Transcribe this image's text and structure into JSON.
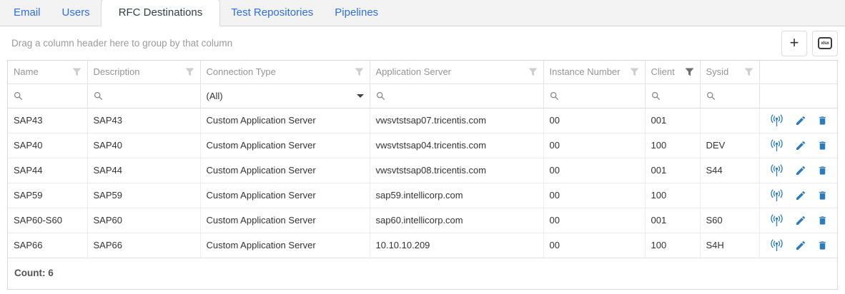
{
  "tabs": [
    {
      "label": "Email",
      "active": false
    },
    {
      "label": "Users",
      "active": false
    },
    {
      "label": "RFC Destinations",
      "active": true
    },
    {
      "label": "Test Repositories",
      "active": false
    },
    {
      "label": "Pipelines",
      "active": false
    }
  ],
  "toolbar": {
    "group_panel_text": "Drag a column header here to group by that column",
    "add_button_glyph": "+",
    "export_button_glyph": "xlsx"
  },
  "grid": {
    "columns": [
      {
        "label": "Name",
        "filter_icon": "funnel"
      },
      {
        "label": "Description",
        "filter_icon": "funnel"
      },
      {
        "label": "Connection Type",
        "filter_icon": "funnel"
      },
      {
        "label": "Application Server",
        "filter_icon": "funnel"
      },
      {
        "label": "Instance Number",
        "filter_icon": "funnel"
      },
      {
        "label": "Client",
        "filter_icon": "funnel-active"
      },
      {
        "label": "Sysid",
        "filter_icon": "funnel"
      }
    ],
    "filter_row": {
      "connection_type_selected": "(All)"
    },
    "rows": [
      {
        "name": "SAP43",
        "description": "SAP43",
        "connection_type": "Custom Application Server",
        "application_server": "vwsvtstsap07.tricentis.com",
        "instance_number": "00",
        "client": "001",
        "sysid": ""
      },
      {
        "name": "SAP40",
        "description": "SAP40",
        "connection_type": "Custom Application Server",
        "application_server": "vwsvtstsap04.tricentis.com",
        "instance_number": "00",
        "client": "100",
        "sysid": "DEV"
      },
      {
        "name": "SAP44",
        "description": "SAP44",
        "connection_type": "Custom Application Server",
        "application_server": "vwsvtstsap08.tricentis.com",
        "instance_number": "00",
        "client": "001",
        "sysid": "S44"
      },
      {
        "name": "SAP59",
        "description": "SAP59",
        "connection_type": "Custom Application Server",
        "application_server": "sap59.intellicorp.com",
        "instance_number": "00",
        "client": "100",
        "sysid": ""
      },
      {
        "name": "SAP60-S60",
        "description": "SAP60",
        "connection_type": "Custom Application Server",
        "application_server": "sap60.intellicorp.com",
        "instance_number": "00",
        "client": "001",
        "sysid": "S60"
      },
      {
        "name": "SAP66",
        "description": "SAP66",
        "connection_type": "Custom Application Server",
        "application_server": "10.10.10.209",
        "instance_number": "00",
        "client": "100",
        "sysid": "S4H"
      }
    ],
    "row_actions": [
      "ping-connection",
      "edit",
      "delete"
    ],
    "footer": {
      "count_text": "Count: 6"
    }
  },
  "colors": {
    "tab_link": "#2e6fe0",
    "action_icon_blue": "#2b7bbd",
    "header_text": "#959595",
    "active_filter_funnel": "#6e6e6e"
  }
}
